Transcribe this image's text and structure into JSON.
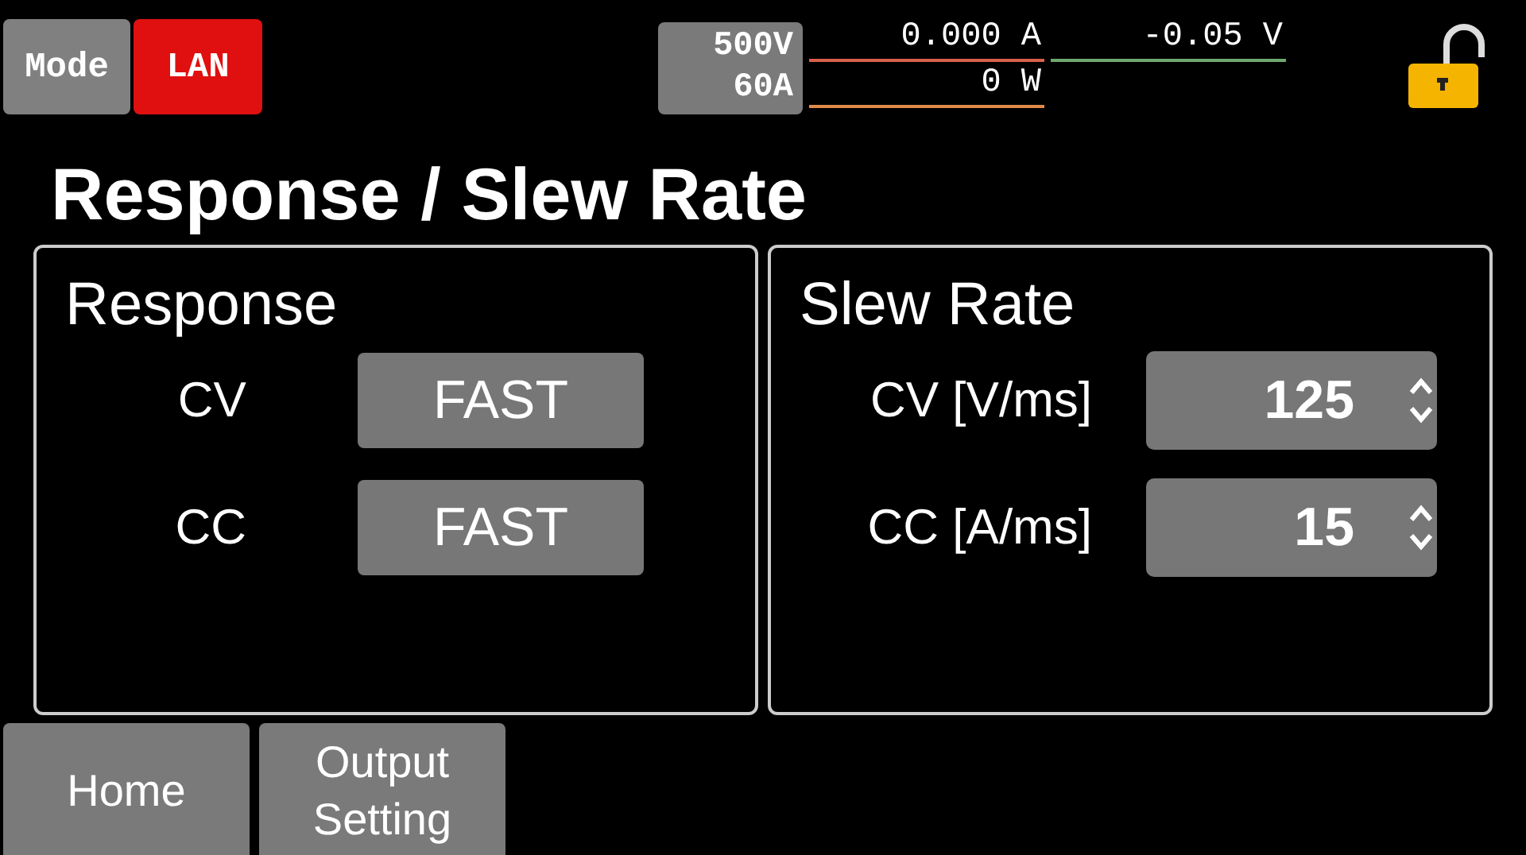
{
  "status_bar": {
    "mode_button": "Mode",
    "interface_badge": "LAN",
    "ratings": [
      "500V",
      "60A"
    ],
    "readings": [
      {
        "value": "0.000 A",
        "color": "#d9604a"
      },
      {
        "value": "-0.05 V",
        "color": "#6fa86f"
      },
      {
        "value": "0 W",
        "color": "#e08a4a"
      }
    ],
    "lock": {
      "locked": false
    }
  },
  "title": "Response / Slew Rate",
  "panels": [
    {
      "heading": "Response",
      "rows": [
        {
          "kind": "button",
          "label": "CV",
          "value": "FAST"
        },
        {
          "kind": "button",
          "label": "CC",
          "value": "FAST"
        }
      ]
    },
    {
      "heading": "Slew Rate",
      "rows": [
        {
          "kind": "spinner",
          "label": "CV [V/ms]",
          "value": "125"
        },
        {
          "kind": "spinner",
          "label": "CC [A/ms]",
          "value": "15"
        }
      ]
    }
  ],
  "bottom_tabs": [
    "Home",
    "Output Setting"
  ]
}
